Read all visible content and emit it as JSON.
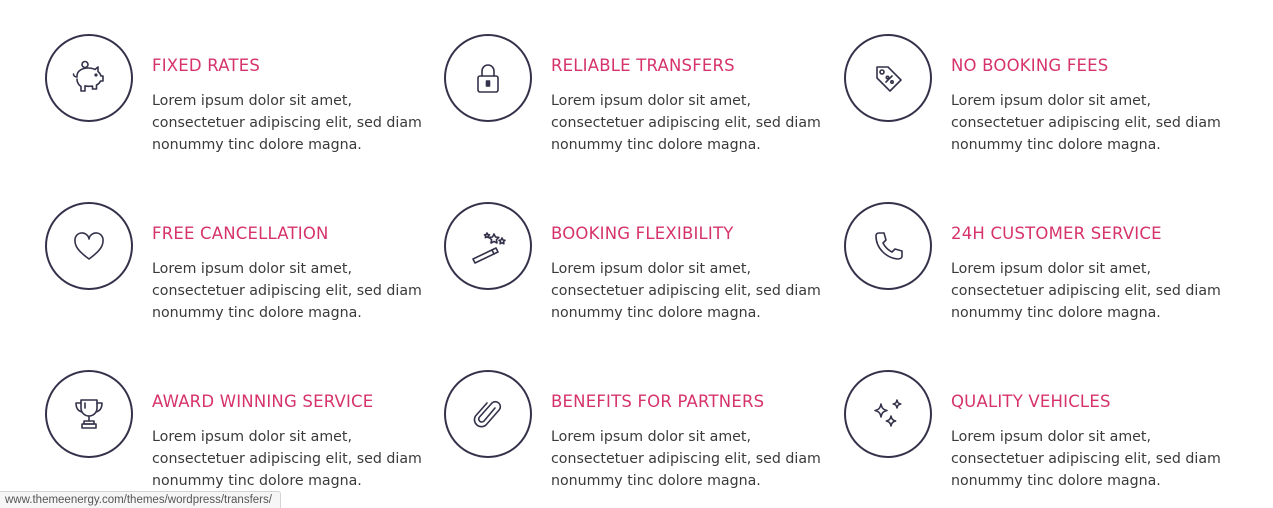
{
  "colors": {
    "accent": "#d6336c",
    "icon_stroke": "#33324a",
    "body_text": "#3a3a3a"
  },
  "features": [
    {
      "icon": "piggy-bank-icon",
      "title": "FIXED RATES",
      "text": "Lorem ipsum dolor sit amet, consectetuer adipiscing elit, sed diam nonummy tinc dolore magna."
    },
    {
      "icon": "lock-icon",
      "title": "RELIABLE TRANSFERS",
      "text": "Lorem ipsum dolor sit amet, consectetuer adipiscing elit, sed diam nonummy tinc dolore magna."
    },
    {
      "icon": "price-tag-icon",
      "title": "NO BOOKING FEES",
      "text": "Lorem ipsum dolor sit amet, consectetuer adipiscing elit, sed diam nonummy tinc dolore magna."
    },
    {
      "icon": "heart-icon",
      "title": "FREE CANCELLATION",
      "text": "Lorem ipsum dolor sit amet, consectetuer adipiscing elit, sed diam nonummy tinc dolore magna."
    },
    {
      "icon": "magic-wand-icon",
      "title": "BOOKING FLEXIBILITY",
      "text": "Lorem ipsum dolor sit amet, consectetuer adipiscing elit, sed diam nonummy tinc dolore magna."
    },
    {
      "icon": "phone-icon",
      "title": "24H CUSTOMER SERVICE",
      "text": "Lorem ipsum dolor sit amet, consectetuer adipiscing elit, sed diam nonummy tinc dolore magna."
    },
    {
      "icon": "trophy-icon",
      "title": "AWARD WINNING SERVICE",
      "text": "Lorem ipsum dolor sit amet, consectetuer adipiscing elit, sed diam nonummy tinc dolore magna."
    },
    {
      "icon": "paperclip-icon",
      "title": "BENEFITS FOR PARTNERS",
      "text": "Lorem ipsum dolor sit amet, consectetuer adipiscing elit, sed diam nonummy tinc dolore magna."
    },
    {
      "icon": "sparkles-icon",
      "title": "QUALITY VEHICLES",
      "text": "Lorem ipsum dolor sit amet, consectetuer adipiscing elit, sed diam nonummy tinc dolore magna."
    }
  ],
  "status_bar": {
    "url": "www.themeenergy.com/themes/wordpress/transfers/"
  }
}
